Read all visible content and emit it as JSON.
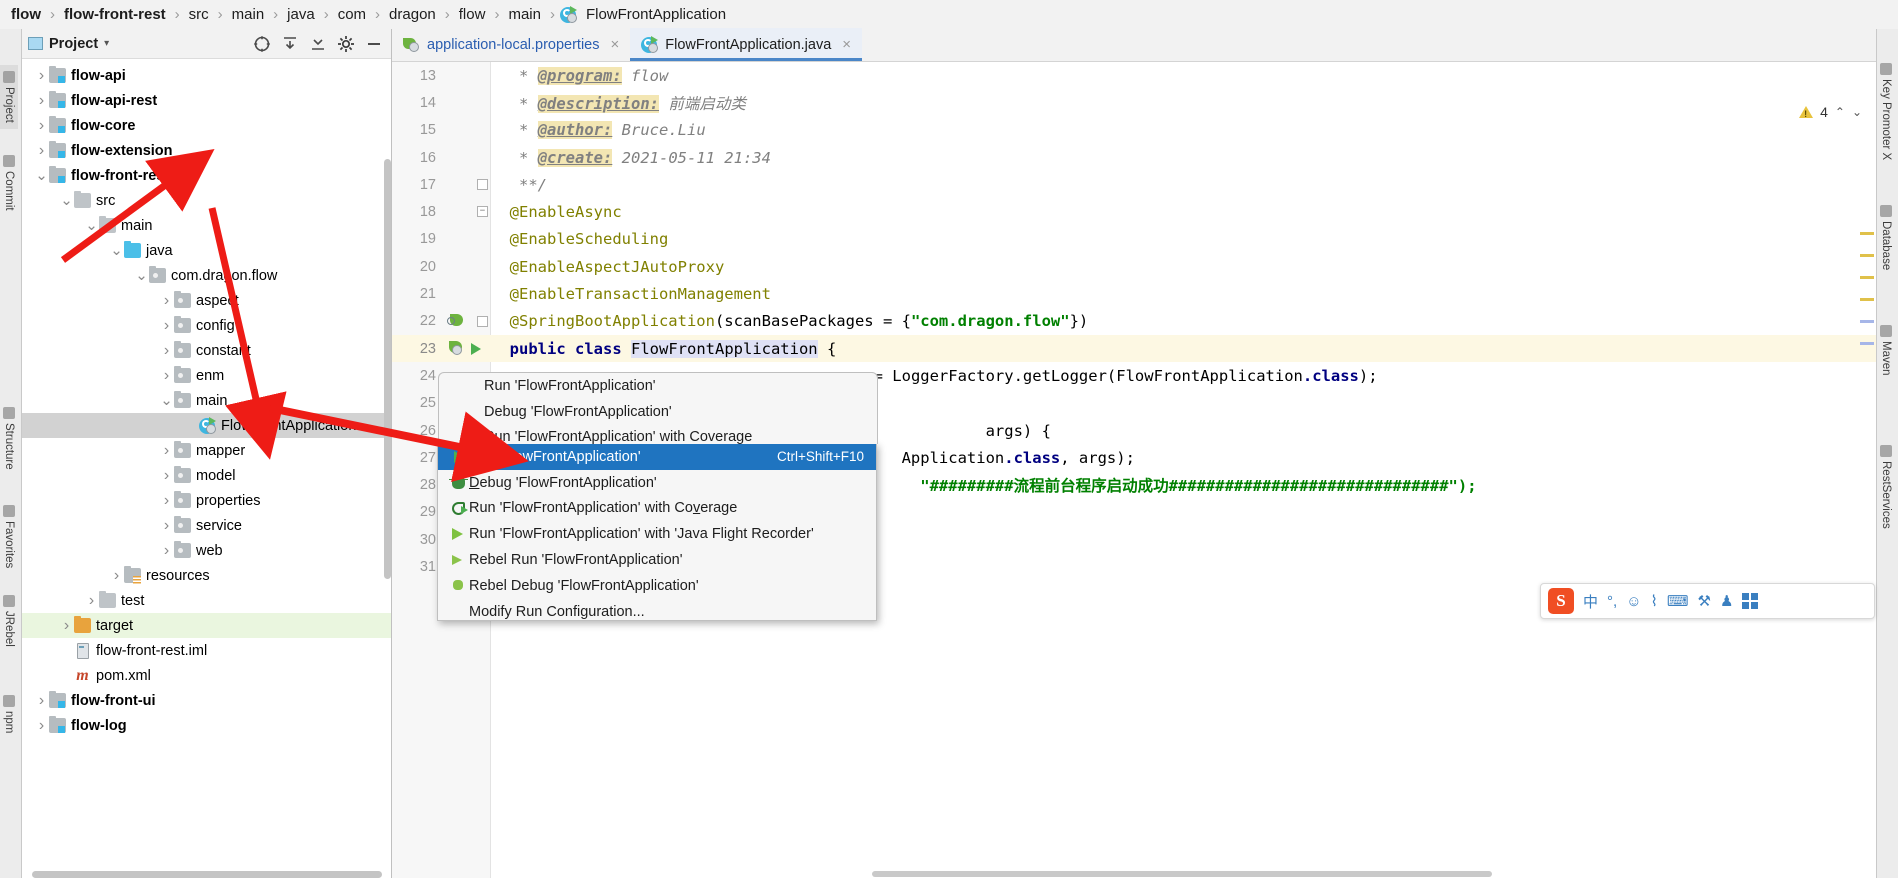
{
  "breadcrumb": {
    "items": [
      {
        "label": "flow",
        "bold": true,
        "icon": null
      },
      {
        "label": "flow-front-rest",
        "bold": true,
        "icon": null
      },
      {
        "label": "src",
        "bold": false,
        "icon": null
      },
      {
        "label": "main",
        "bold": false,
        "icon": null
      },
      {
        "label": "java",
        "bold": false,
        "icon": null
      },
      {
        "label": "com",
        "bold": false,
        "icon": null
      },
      {
        "label": "dragon",
        "bold": false,
        "icon": null
      },
      {
        "label": "flow",
        "bold": false,
        "icon": null
      },
      {
        "label": "main",
        "bold": false,
        "icon": null
      },
      {
        "label": "FlowFrontApplication",
        "bold": false,
        "icon": "java-class-icon"
      }
    ],
    "separator": "›"
  },
  "left_rail": {
    "items": [
      "Project",
      "Commit",
      "Structure",
      "Favorites",
      "JRebel",
      "npm"
    ]
  },
  "right_rail": {
    "items": [
      "Key Promoter X",
      "Database",
      "Maven",
      "RestServices"
    ]
  },
  "project_panel": {
    "title": "Project",
    "caret": "▾",
    "toolbar": [
      {
        "name": "locate-icon",
        "glyph": "⊕"
      },
      {
        "name": "collapse-all-icon",
        "glyph": "↧"
      },
      {
        "name": "expand-all-icon",
        "glyph": "↥"
      },
      {
        "name": "settings-gear-icon",
        "glyph": "⚙"
      },
      {
        "name": "hide-icon",
        "glyph": "—"
      }
    ],
    "tree": [
      {
        "label": "flow-api",
        "indent": 0,
        "arrow": "collapsed",
        "icon": "module-folder-icon",
        "bold": true,
        "state": "normal"
      },
      {
        "label": "flow-api-rest",
        "indent": 0,
        "arrow": "collapsed",
        "icon": "module-folder-icon",
        "bold": true,
        "state": "normal"
      },
      {
        "label": "flow-core",
        "indent": 0,
        "arrow": "collapsed",
        "icon": "module-folder-icon",
        "bold": true,
        "state": "normal"
      },
      {
        "label": "flow-extension",
        "indent": 0,
        "arrow": "collapsed",
        "icon": "module-folder-icon",
        "bold": true,
        "state": "normal"
      },
      {
        "label": "flow-front-rest",
        "indent": 0,
        "arrow": "expanded",
        "icon": "module-folder-icon",
        "bold": true,
        "state": "normal"
      },
      {
        "label": "src",
        "indent": 1,
        "arrow": "expanded",
        "icon": "folder-icon",
        "bold": false,
        "state": "normal"
      },
      {
        "label": "main",
        "indent": 2,
        "arrow": "expanded",
        "icon": "folder-icon",
        "bold": false,
        "state": "normal"
      },
      {
        "label": "java",
        "indent": 3,
        "arrow": "expanded",
        "icon": "source-root-icon",
        "bold": false,
        "state": "normal"
      },
      {
        "label": "com.dragon.flow",
        "indent": 4,
        "arrow": "expanded",
        "icon": "package-icon",
        "bold": false,
        "state": "normal"
      },
      {
        "label": "aspect",
        "indent": 5,
        "arrow": "collapsed",
        "icon": "package-icon",
        "bold": false,
        "state": "normal"
      },
      {
        "label": "config",
        "indent": 5,
        "arrow": "collapsed",
        "icon": "package-icon",
        "bold": false,
        "state": "normal"
      },
      {
        "label": "constant",
        "indent": 5,
        "arrow": "collapsed",
        "icon": "package-icon",
        "bold": false,
        "state": "normal"
      },
      {
        "label": "enm",
        "indent": 5,
        "arrow": "collapsed",
        "icon": "package-icon",
        "bold": false,
        "state": "normal"
      },
      {
        "label": "main",
        "indent": 5,
        "arrow": "expanded",
        "icon": "package-icon",
        "bold": false,
        "state": "normal"
      },
      {
        "label": "FlowFrontApplication",
        "indent": 6,
        "arrow": "none",
        "icon": "java-class-icon",
        "bold": false,
        "state": "selected"
      },
      {
        "label": "mapper",
        "indent": 5,
        "arrow": "collapsed",
        "icon": "package-icon",
        "bold": false,
        "state": "normal"
      },
      {
        "label": "model",
        "indent": 5,
        "arrow": "collapsed",
        "icon": "package-icon",
        "bold": false,
        "state": "normal"
      },
      {
        "label": "properties",
        "indent": 5,
        "arrow": "collapsed",
        "icon": "package-icon",
        "bold": false,
        "state": "normal"
      },
      {
        "label": "service",
        "indent": 5,
        "arrow": "collapsed",
        "icon": "package-icon",
        "bold": false,
        "state": "normal"
      },
      {
        "label": "web",
        "indent": 5,
        "arrow": "collapsed",
        "icon": "package-icon",
        "bold": false,
        "state": "normal"
      },
      {
        "label": "resources",
        "indent": 3,
        "arrow": "collapsed",
        "icon": "resources-root-icon",
        "bold": false,
        "state": "normal"
      },
      {
        "label": "test",
        "indent": 2,
        "arrow": "collapsed",
        "icon": "folder-icon",
        "bold": false,
        "state": "normal"
      },
      {
        "label": "target",
        "indent": 1,
        "arrow": "collapsed",
        "icon": "target-folder-icon",
        "bold": false,
        "state": "excluded"
      },
      {
        "label": "flow-front-rest.iml",
        "indent": 1,
        "arrow": "none",
        "icon": "iml-file-icon",
        "bold": false,
        "state": "normal"
      },
      {
        "label": "pom.xml",
        "indent": 1,
        "arrow": "none",
        "icon": "maven-pom-icon",
        "bold": false,
        "state": "normal"
      },
      {
        "label": "flow-front-ui",
        "indent": 0,
        "arrow": "collapsed",
        "icon": "module-folder-icon",
        "bold": true,
        "state": "normal"
      },
      {
        "label": "flow-log",
        "indent": 0,
        "arrow": "collapsed",
        "icon": "module-folder-icon",
        "bold": true,
        "state": "normal"
      }
    ]
  },
  "editor": {
    "tabs": [
      {
        "label": "application-local.properties",
        "icon": "spring-properties-icon",
        "active": false,
        "close": "×"
      },
      {
        "label": "FlowFrontApplication.java",
        "icon": "spring-class-icon",
        "active": true,
        "close": "×"
      }
    ],
    "inspection": {
      "warning_count": "4",
      "up": "⌃",
      "down": "⌄"
    },
    "lines": [
      {
        "num": "13",
        "fold": null,
        "highlight": false,
        "tokens": [
          {
            "t": "   * ",
            "c": "cmt"
          },
          {
            "t": "@program:",
            "c": "cmt-tag"
          },
          {
            "t": " flow",
            "c": "cmt"
          }
        ]
      },
      {
        "num": "14",
        "fold": null,
        "highlight": false,
        "tokens": [
          {
            "t": "   * ",
            "c": "cmt"
          },
          {
            "t": "@description:",
            "c": "cmt-tag"
          },
          {
            "t": " 前端启动类",
            "c": "cmt"
          }
        ]
      },
      {
        "num": "15",
        "fold": null,
        "highlight": false,
        "tokens": [
          {
            "t": "   * ",
            "c": "cmt"
          },
          {
            "t": "@author:",
            "c": "cmt-tag"
          },
          {
            "t": " Bruce.Liu",
            "c": "cmt"
          }
        ]
      },
      {
        "num": "16",
        "fold": null,
        "highlight": false,
        "tokens": [
          {
            "t": "   * ",
            "c": "cmt"
          },
          {
            "t": "@create:",
            "c": "cmt-tag"
          },
          {
            "t": " 2021-05-11 21:34",
            "c": "cmt"
          }
        ]
      },
      {
        "num": "17",
        "fold": "end",
        "highlight": false,
        "tokens": [
          {
            "t": "   **/",
            "c": "cmt"
          }
        ]
      },
      {
        "num": "18",
        "fold": "start",
        "highlight": false,
        "tokens": [
          {
            "t": "  @EnableAsync",
            "c": "ann"
          }
        ]
      },
      {
        "num": "19",
        "fold": null,
        "highlight": false,
        "tokens": [
          {
            "t": "  @EnableScheduling",
            "c": "ann"
          }
        ]
      },
      {
        "num": "20",
        "fold": null,
        "highlight": false,
        "tokens": [
          {
            "t": "  @EnableAspectJAutoProxy",
            "c": "ann"
          }
        ]
      },
      {
        "num": "21",
        "fold": null,
        "highlight": false,
        "tokens": [
          {
            "t": "  @EnableTransactionManagement",
            "c": "ann"
          }
        ]
      },
      {
        "num": "22",
        "fold": "end",
        "highlight": false,
        "gutter_icon": "spring-bean-icon",
        "tokens": [
          {
            "t": "  @SpringBootApplication",
            "c": "ann"
          },
          {
            "t": "(scanBasePackages = {",
            "c": "plain"
          },
          {
            "t": "\"com.dragon.flow\"",
            "c": "str"
          },
          {
            "t": "})",
            "c": "plain"
          }
        ]
      },
      {
        "num": "23",
        "fold": null,
        "highlight": true,
        "gutter_icon": "spring-run-icon",
        "tokens": [
          {
            "t": "  ",
            "c": "plain"
          },
          {
            "t": "public class ",
            "c": "k"
          },
          {
            "t": "FlowFrontApplication",
            "c": "cls-sel"
          },
          {
            "t": " {",
            "c": "plain"
          }
        ]
      },
      {
        "num": "24",
        "fold": null,
        "highlight": false,
        "tokens": [
          {
            "t": "                                      ",
            "c": "plain"
          },
          {
            "t": "er",
            "c": "fld"
          },
          {
            "t": " = LoggerFactory.getLogger(FlowFrontApplication",
            "c": "plain"
          },
          {
            "t": ".class",
            "c": "k"
          },
          {
            "t": ");",
            "c": "plain"
          }
        ]
      },
      {
        "num": "25",
        "fold": null,
        "highlight": false,
        "tokens": []
      },
      {
        "num": "26",
        "fold": "start",
        "highlight": false,
        "tokens": [
          {
            "t": "                                                     args) {",
            "c": "plain"
          }
        ]
      },
      {
        "num": "27",
        "fold": null,
        "highlight": false,
        "tokens": [
          {
            "t": "                                            Application",
            "c": "plain"
          },
          {
            "t": ".class",
            "c": "k"
          },
          {
            "t": ", args);",
            "c": "plain"
          }
        ]
      },
      {
        "num": "28",
        "fold": null,
        "highlight": false,
        "tokens": [
          {
            "t": "                                              \"#########流程前台程序启动成功##############################\");",
            "c": "str"
          }
        ]
      },
      {
        "num": "29",
        "fold": null,
        "highlight": false,
        "tokens": []
      },
      {
        "num": "30",
        "fold": null,
        "highlight": false,
        "tokens": []
      },
      {
        "num": "31",
        "fold": null,
        "highlight": false,
        "tokens": []
      }
    ]
  },
  "context_menu": {
    "items": [
      {
        "label": "Run 'FlowFrontApplication'",
        "icon": null,
        "shortcut": "",
        "selected": false,
        "underline": ""
      },
      {
        "label": "Debug 'FlowFrontApplication'",
        "icon": null,
        "shortcut": "",
        "selected": false,
        "underline": ""
      },
      {
        "label": "Run 'FlowFrontApplication' with Coverage",
        "icon": null,
        "shortcut": "",
        "selected": false,
        "underline": ""
      },
      {
        "label": "Run 'FlowFrontApplication'",
        "icon": "run-icon",
        "shortcut": "Ctrl+Shift+F10",
        "selected": true,
        "underline": "u"
      },
      {
        "label": "Debug 'FlowFrontApplication'",
        "icon": "debug-icon",
        "shortcut": "",
        "selected": false,
        "underline": "D"
      },
      {
        "label": "Run 'FlowFrontApplication' with Coverage",
        "icon": "coverage-icon",
        "shortcut": "",
        "selected": false,
        "underline": "v"
      },
      {
        "label": "Run 'FlowFrontApplication' with 'Java Flight Recorder'",
        "icon": "jfr-icon",
        "shortcut": "",
        "selected": false,
        "underline": ""
      },
      {
        "label": "Rebel Run 'FlowFrontApplication'",
        "icon": "rebel-run-icon",
        "shortcut": "",
        "selected": false,
        "underline": ""
      },
      {
        "label": "Rebel Debug 'FlowFrontApplication'",
        "icon": "rebel-debug-icon",
        "shortcut": "",
        "selected": false,
        "underline": ""
      },
      {
        "label": "Modify Run Configuration...",
        "icon": null,
        "shortcut": "",
        "selected": false,
        "underline": ""
      }
    ]
  },
  "ime_toolbar": {
    "logo": "S",
    "items": [
      {
        "name": "chinese-mode-label",
        "glyph": "中"
      },
      {
        "name": "punctuation-icon",
        "glyph": "°,"
      },
      {
        "name": "emoji-icon",
        "glyph": "☺"
      },
      {
        "name": "voice-input-icon",
        "glyph": "⌇"
      },
      {
        "name": "keyboard-icon",
        "glyph": "⌨"
      },
      {
        "name": "toolbox-icon",
        "glyph": "⚒"
      },
      {
        "name": "skin-icon",
        "glyph": "♟"
      },
      {
        "name": "menu-grid-icon",
        "glyph": "⊞"
      }
    ]
  },
  "colors": {
    "selection_blue": "#1f74c0",
    "annotation_yellow": "#808000",
    "string_green": "#008000",
    "keyword_navy": "#000080",
    "line_highlight": "#fdf8e3",
    "tree_selection": "#d2d2d2",
    "arrow_red": "#ee1c16"
  }
}
